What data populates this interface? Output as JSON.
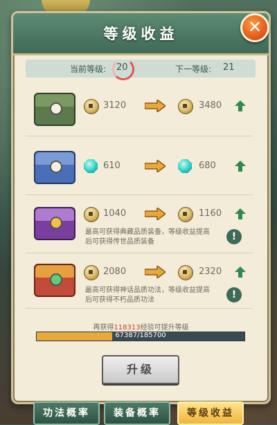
{
  "title": "等级收益",
  "level": {
    "current_label": "当前等级:",
    "current_value": "20",
    "next_label": "下一等级:",
    "next_value": "21"
  },
  "rows": [
    {
      "icon": "green-chest",
      "currency": "coin",
      "from": "3120",
      "to": "3480",
      "desc": ""
    },
    {
      "icon": "blue-chest",
      "currency": "gem",
      "from": "610",
      "to": "680",
      "desc": ""
    },
    {
      "icon": "purple-chest",
      "currency": "coin",
      "from": "1040",
      "to": "1160",
      "desc": "最高可获得典藏品质装备，等级收益提高后可获得传世品质装备"
    },
    {
      "icon": "red-chest",
      "currency": "coin",
      "from": "2080",
      "to": "2320",
      "desc": "最高可获得神话品质功法，等级收益提高后可获得不朽品质功法"
    }
  ],
  "exp": {
    "prefix": "再获得",
    "amount": "118313",
    "suffix": "经验可提升等级",
    "progress_text": "67387/185700",
    "progress_fraction": 0.3629
  },
  "upgrade_button": "升级",
  "tabs": [
    "功法概率",
    "装备概率",
    "等级收益"
  ],
  "active_tab": 2,
  "colors": {
    "header": "#4d7a66",
    "accent": "#e25555",
    "progress": "#e8a93a"
  }
}
